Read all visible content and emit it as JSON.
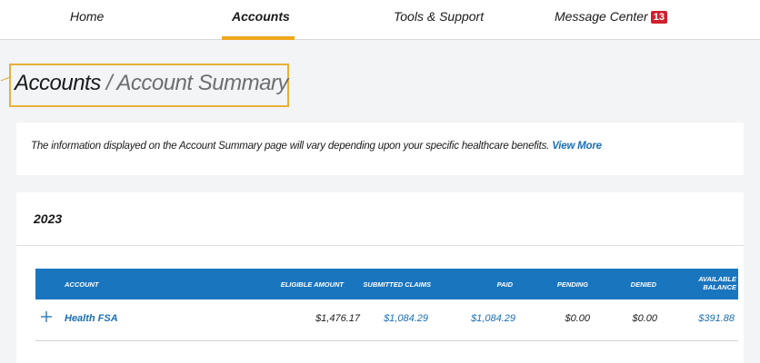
{
  "nav": {
    "items": [
      {
        "label": "Home"
      },
      {
        "label": "Accounts"
      },
      {
        "label": "Tools & Support"
      },
      {
        "label": "Message Center",
        "badge": "13"
      }
    ],
    "active": "Accounts",
    "accent_color": "#f0a81b",
    "badge_color": "#d0202e"
  },
  "breadcrumb": {
    "main": "Accounts",
    "separator": " / ",
    "current": "Account Summary"
  },
  "info": {
    "text": "The information displayed on the Account Summary page will vary depending upon your specific healthcare benefits.",
    "link": "View More"
  },
  "summary": {
    "year": "2023",
    "columns": {
      "account": "ACCOUNT",
      "eligible": "ELIGIBLE AMOUNT",
      "submitted": "SUBMITTED CLAIMS",
      "paid": "PAID",
      "pending": "PENDING",
      "denied": "DENIED",
      "available_line1": "AVAILABLE",
      "available_line2": "BALANCE"
    },
    "rows": [
      {
        "account": "Health FSA",
        "eligible": "$1,476.17",
        "submitted": "$1,084.29",
        "paid": "$1,084.29",
        "pending": "$0.00",
        "denied": "$0.00",
        "available": "$391.88"
      }
    ],
    "header_color": "#1a75bf",
    "link_color": "#1a6fb7"
  }
}
